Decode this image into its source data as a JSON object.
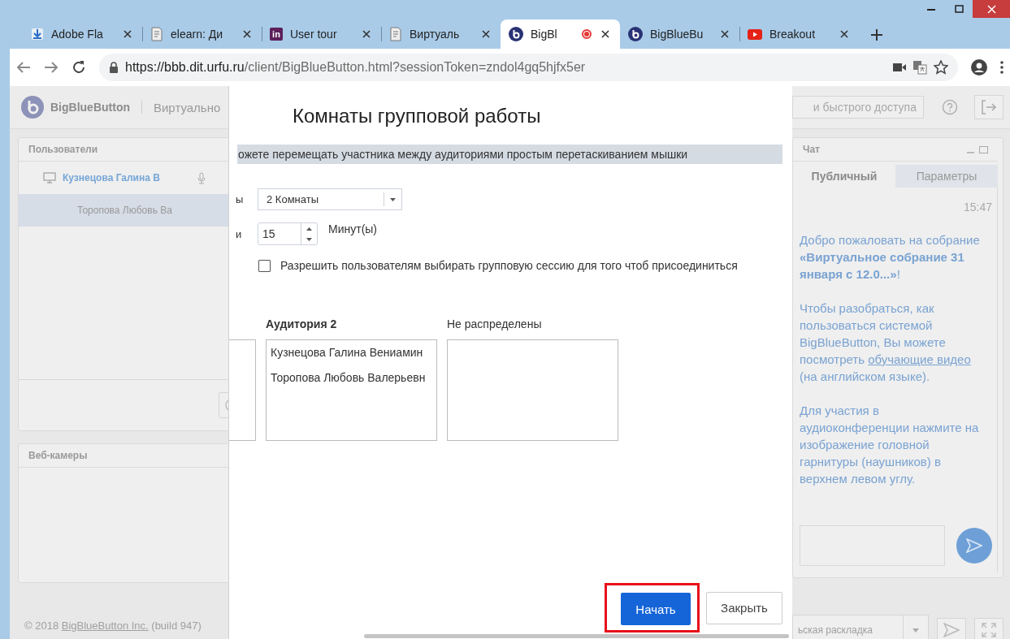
{
  "browser": {
    "tabs": [
      {
        "title": "Adobe Fla",
        "kind": "download",
        "selected": false,
        "recording": false
      },
      {
        "title": "elearn: Ди",
        "kind": "page",
        "selected": false,
        "recording": false
      },
      {
        "title": "User tour",
        "kind": "square",
        "icon_text": "in",
        "selected": false,
        "recording": false
      },
      {
        "title": "Виртуаль",
        "kind": "page",
        "selected": false,
        "recording": false
      },
      {
        "title": "BigBl",
        "kind": "bbb",
        "selected": true,
        "recording": true
      },
      {
        "title": "BigBlueBu",
        "kind": "bbb",
        "selected": false,
        "recording": false
      },
      {
        "title": "Breakout",
        "kind": "video",
        "selected": false,
        "recording": false
      }
    ],
    "url_host": "https://bbb.dit.urfu.ru",
    "url_path": "/client/BigBlueButton.html?sessionToken=zndol4gq5hjfx5er"
  },
  "app": {
    "logo": "BigBlueButton",
    "meeting_title": "Виртуально",
    "search": {
      "placeholder": "и быстрого доступа"
    },
    "users_panel": {
      "title": "Пользователи",
      "users": [
        {
          "name": "Кузнецова Галина В",
          "presenter": true,
          "selected": false
        },
        {
          "name": "Торопова Любовь Ва",
          "presenter": false,
          "selected": true
        }
      ]
    },
    "webcams_panel": {
      "title": "Веб-камеры"
    },
    "footer": {
      "before": "© 2018",
      "link": "BigBlueButton Inc.",
      "after": "(build 947)"
    },
    "chat": {
      "title": "Чат",
      "tabs": [
        {
          "label": "Публичный",
          "selected": true
        },
        {
          "label": "Параметры",
          "selected": false
        }
      ],
      "time": "15:47",
      "messages": [
        {
          "kind": "rich",
          "text": "Добро пожаловать на собрание **«Виртуальное собрание 31 января  с 12.0...»**!"
        },
        {
          "kind": "link",
          "before": "Чтобы разобраться, как пользоваться системой BigBlueButton, Вы можете посмотреть",
          "link": "обучающие видео",
          "after": "(на английском языке)."
        },
        {
          "kind": "rich",
          "text": "Для участия в аудиоконференции нажмите на изображение головной гарнитуры (наушников) в верхнем левом углу."
        }
      ]
    },
    "layout_select": "ьская раскладка"
  },
  "modal": {
    "title": "Комнаты групповой работы",
    "info": "ожете перемещать участника между аудиториями простым перетаскиванием мышки",
    "rooms_label": "ы",
    "rooms_select": "2 Комнаты",
    "duration_label": "и",
    "duration_value": "15",
    "duration_unit": "Минут(ы)",
    "allow_choice": {
      "label": "Разрешить пользователям выбирать групповую сессию для того чтоб присоединиться",
      "checked": false
    },
    "rooms": [
      {
        "kind": "partial"
      },
      {
        "kind": "room",
        "title": "Аудитория 2",
        "members": [
          "Кузнецова Галина Вениамин",
          "Торопова Любовь Валерьевн"
        ]
      },
      {
        "kind": "unassigned",
        "title": "Не распределены"
      }
    ],
    "buttons": [
      {
        "label": "Начать",
        "kind": "primary",
        "highlighted": true
      },
      {
        "label": "Закрыть",
        "kind": "secondary",
        "highlighted": false
      }
    ]
  }
}
